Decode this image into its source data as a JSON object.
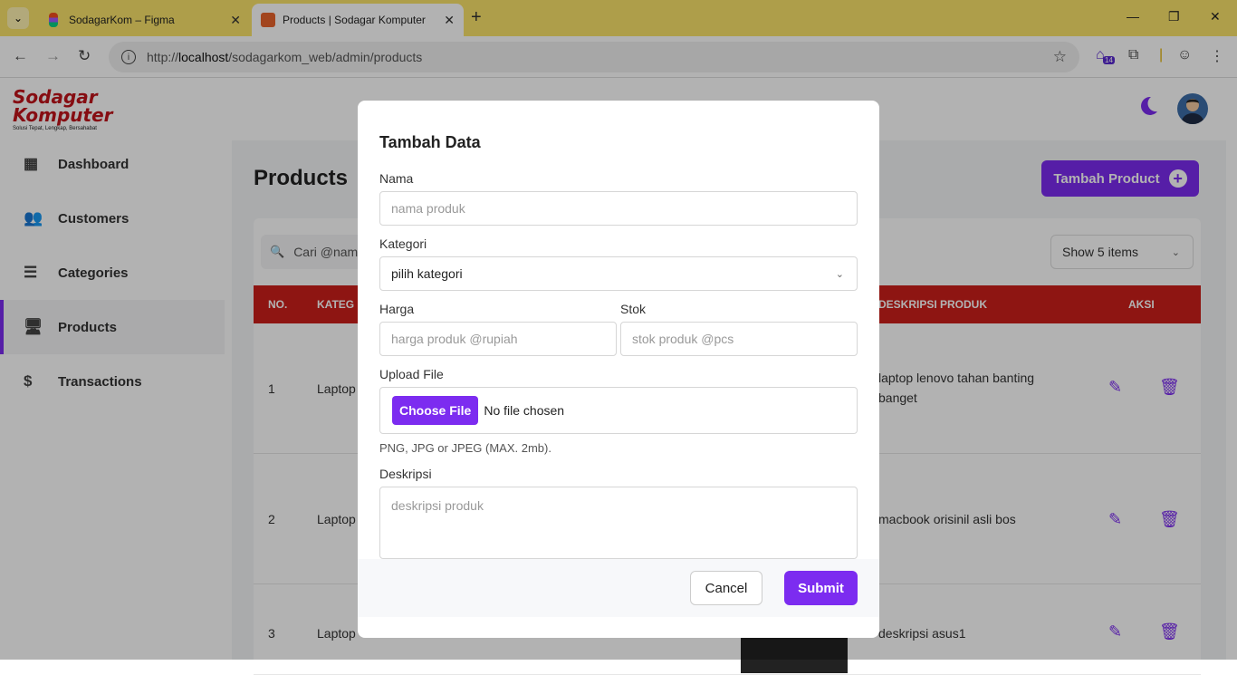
{
  "browser": {
    "tabs": [
      {
        "title": "SodagarKom – Figma",
        "active": false
      },
      {
        "title": "Products | Sodagar Komputer",
        "active": true
      }
    ],
    "url_scheme": "http://",
    "url_host": "localhost",
    "url_path": "/sodagarkom_web/admin/products",
    "extension_badge": "14"
  },
  "app": {
    "logo_line1": "Sodagar",
    "logo_line2": "Komputer",
    "logo_tagline": "Solusi Tepat, Lengkap, Bersahabat",
    "nav": [
      {
        "label": "Dashboard",
        "icon": "dashboard-icon",
        "active": false
      },
      {
        "label": "Customers",
        "icon": "customers-icon",
        "active": false
      },
      {
        "label": "Categories",
        "icon": "categories-icon",
        "active": false
      },
      {
        "label": "Products",
        "icon": "monitor-icon",
        "active": true
      },
      {
        "label": "Transactions",
        "icon": "dollar-icon",
        "active": false
      }
    ],
    "page_title": "Products",
    "add_button": "Tambah Product",
    "search_placeholder": "Cari @nama",
    "show_items": "Show 5 items",
    "table_headers": {
      "no": "NO.",
      "kategori": "KATEG",
      "deskripsi": "DESKRIPSI PRODUK",
      "aksi": "AKSI"
    },
    "rows": [
      {
        "no": "1",
        "kategori": "Laptop",
        "deskripsi_line1": "laptop lenovo tahan banting",
        "deskripsi_line2": "banget"
      },
      {
        "no": "2",
        "kategori": "Laptop",
        "deskripsi_line1": "macbook orisinil asli bos",
        "deskripsi_line2": ""
      },
      {
        "no": "3",
        "kategori": "Laptop",
        "deskripsi_line1": "deskripsi asus1",
        "deskripsi_line2": ""
      }
    ]
  },
  "modal": {
    "title": "Tambah Data",
    "nama_label": "Nama",
    "nama_placeholder": "nama produk",
    "kategori_label": "Kategori",
    "kategori_value": "pilih kategori",
    "harga_label": "Harga",
    "harga_placeholder": "harga produk @rupiah",
    "stok_label": "Stok",
    "stok_placeholder": "stok produk @pcs",
    "upload_label": "Upload File",
    "choose_file": "Choose File",
    "no_file": "No file chosen",
    "file_hint": "PNG, JPG or JPEG (MAX. 2mb).",
    "deskripsi_label": "Deskripsi",
    "deskripsi_placeholder": "deskripsi produk",
    "cancel": "Cancel",
    "submit": "Submit"
  },
  "colors": {
    "accent": "#7c2cf0",
    "table_header": "#cc1f1a",
    "tab_bar": "#f9e36a"
  }
}
